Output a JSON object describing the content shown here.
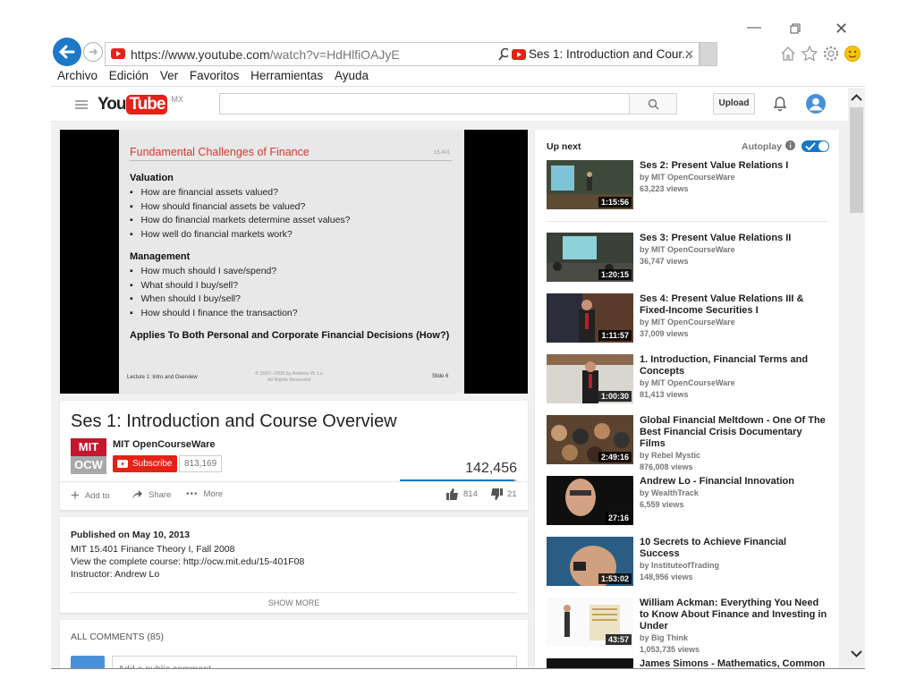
{
  "browser": {
    "url_host": "https://www.youtube.com",
    "url_path": "/watch?v=HdHlfiOAJyE",
    "tab_title": "Ses 1: Introduction and Cour...",
    "menu": [
      "Archivo",
      "Edición",
      "Ver",
      "Favoritos",
      "Herramientas",
      "Ayuda"
    ]
  },
  "masthead": {
    "logo_you": "You",
    "logo_tube": "Tube",
    "region": "MX",
    "upload": "Upload"
  },
  "slide": {
    "title": "Fundamental Challenges of Finance",
    "course_code": "15.401",
    "valuation_heading": "Valuation",
    "valuation_items": [
      "How are financial assets valued?",
      "How should financial assets be valued?",
      "How do financial markets determine asset values?",
      "How well do financial markets work?"
    ],
    "management_heading": "Management",
    "management_items": [
      "How much should I save/spend?",
      "What should I buy/sell?",
      "When should I buy/sell?",
      "How should I finance the transaction?"
    ],
    "applies": "Applies To Both Personal and Corporate Financial Decisions (How?)",
    "footer_left": "Lecture 1: Intro and Overview",
    "footer_mid_1": "© 2007–2008 by Andrew W. Lo",
    "footer_mid_2": "All Rights Reserved",
    "footer_right": "Slide 6"
  },
  "video": {
    "title": "Ses 1: Introduction and Course Overview",
    "channel": "MIT OpenCourseWare",
    "logo_top": "MIT",
    "logo_bottom": "OCW",
    "subscribe": "Subscribe",
    "sub_count": "813,169",
    "views": "142,456",
    "add_to": "Add to",
    "share": "Share",
    "more": "More",
    "likes": "814",
    "dislikes": "21",
    "like_ratio": 0.975
  },
  "description": {
    "published": "Published on May 10, 2013",
    "line1": "MIT 15.401 Finance Theory I, Fall 2008",
    "line2": "View the complete course: http://ocw.mit.edu/15-401F08",
    "line3": "Instructor: Andrew Lo",
    "show_more": "SHOW MORE"
  },
  "comments": {
    "label": "ALL COMMENTS (85)",
    "placeholder": "Add a public comment..."
  },
  "sidebar": {
    "up_next": "Up next",
    "autoplay": "Autoplay",
    "videos": [
      {
        "title": "Ses 2: Present Value Relations I",
        "channel": "by MIT OpenCourseWare",
        "views": "63,223 views",
        "duration": "1:15:56"
      },
      {
        "title": "Ses 3: Present Value Relations II",
        "channel": "by MIT OpenCourseWare",
        "views": "36,747 views",
        "duration": "1:20:15"
      },
      {
        "title": "Ses 4: Present Value Relations III & Fixed-Income Securities I",
        "channel": "by MIT OpenCourseWare",
        "views": "37,009 views",
        "duration": "1:11:57"
      },
      {
        "title": "1. Introduction, Financial Terms and Concepts",
        "channel": "by MIT OpenCourseWare",
        "views": "81,413 views",
        "duration": "1:00:30"
      },
      {
        "title": "Global Financial Meltdown - One Of The Best Financial Crisis Documentary Films",
        "channel": "by Rebel Mystic",
        "views": "876,008 views",
        "duration": "2:49:16"
      },
      {
        "title": "Andrew Lo - Financial Innovation",
        "channel": "by WealthTrack",
        "views": "6,559 views",
        "duration": "27:16"
      },
      {
        "title": "10 Secrets to Achieve Financial Success",
        "channel": "by InstituteofTrading",
        "views": "148,956 views",
        "duration": "1:53:02"
      },
      {
        "title": "William Ackman: Everything You Need to Know About Finance and Investing in Under",
        "channel": "by Big Think",
        "views": "1,053,735 views",
        "duration": "43:57"
      },
      {
        "title": "James Simons - Mathematics, Common",
        "channel": "",
        "views": "",
        "duration": ""
      }
    ]
  },
  "colors": {
    "brand_red": "#e62117",
    "slide_title": "#d9372b",
    "accent_blue": "#167ac6",
    "ie_blue": "#1e78c8"
  }
}
